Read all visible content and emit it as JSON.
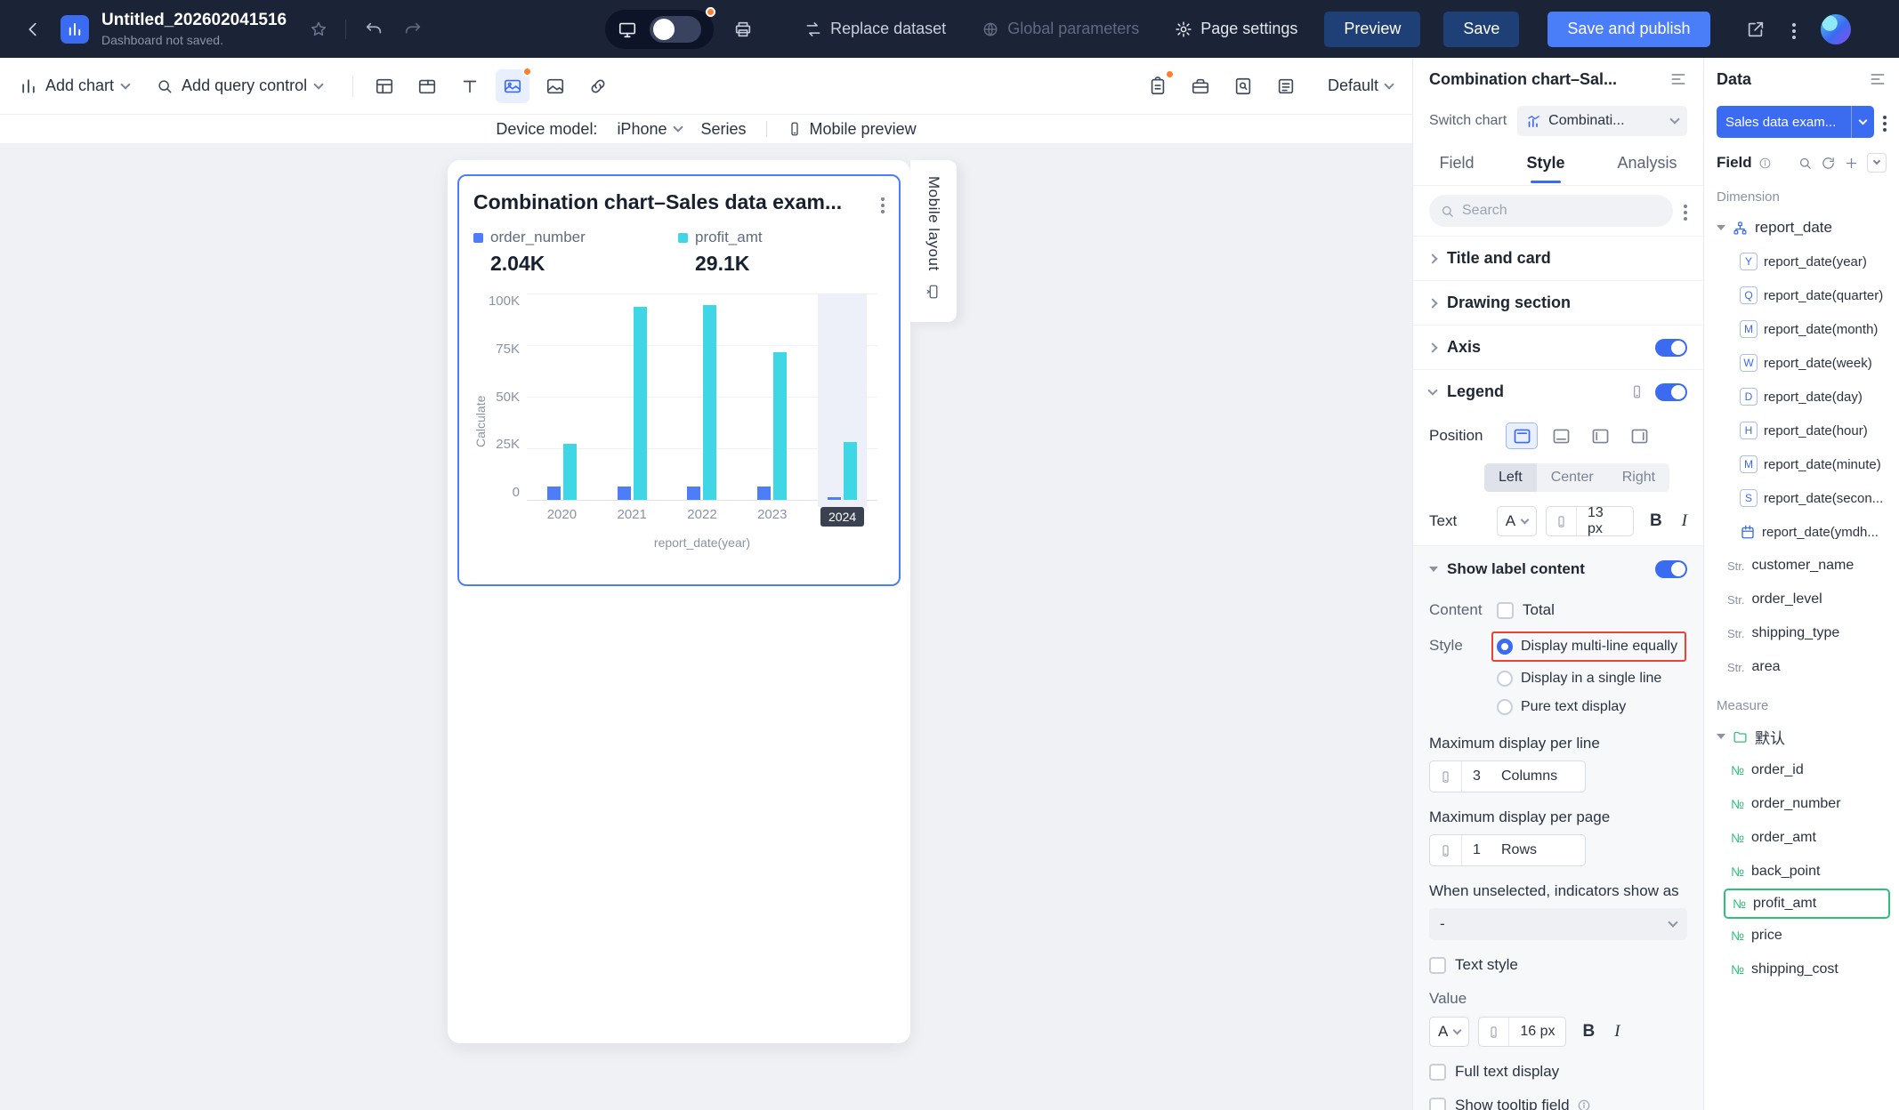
{
  "colors": {
    "accent_blue": "#3a6bf0",
    "publish_blue": "#4a7df8",
    "topbar_bg": "#1b2336",
    "measure_green": "#30bf78",
    "annotation_red": "#f04134"
  },
  "topbar": {
    "title": "Untitled_202602041516",
    "subtitle": "Dashboard not saved.",
    "replace_dataset_label": "Replace dataset",
    "global_parameters_label": "Global parameters",
    "page_settings_label": "Page settings",
    "preview_label": "Preview",
    "save_label": "Save",
    "save_and_publish_label": "Save and publish"
  },
  "toolbar": {
    "add_chart_label": "Add chart",
    "add_query_control_label": "Add query control",
    "theme_label": "Default"
  },
  "devicebar": {
    "device_model_label": "Device model:",
    "device_value": "iPhone",
    "series_label": "Series",
    "mobile_preview_label": "Mobile preview"
  },
  "canvas": {
    "mobile_layout_tab": "Mobile layout",
    "card": {
      "title": "Combination chart–Sales data exam...",
      "legend": [
        {
          "name": "order_number",
          "value": "2.04K"
        },
        {
          "name": "profit_amt",
          "value": "29.1K"
        }
      ]
    }
  },
  "chart_data": {
    "type": "bar",
    "title": "Combination chart–Sales data exam...",
    "categories": [
      "2020",
      "2021",
      "2022",
      "2023",
      "2024"
    ],
    "series": [
      {
        "name": "order_number",
        "color": "#4d7df8",
        "values": [
          6500,
          6500,
          6500,
          6500,
          1500
        ]
      },
      {
        "name": "profit_amt",
        "color": "#3fd6e6",
        "values": [
          27000,
          93500,
          94500,
          71500,
          28000
        ]
      }
    ],
    "legend_display_values": {
      "order_number": "2.04K",
      "profit_amt": "29.1K"
    },
    "xlabel": "report_date(year)",
    "ylabel": "Calculate",
    "yticks": [
      "100K",
      "75K",
      "50K",
      "25K",
      "0"
    ],
    "ylim": [
      0,
      100000
    ],
    "highlighted_category": "2024",
    "legend_position": "top",
    "grid": true
  },
  "style_panel": {
    "header": "Combination chart–Sal...",
    "switch_chart_label": "Switch chart",
    "switch_chart_value": "Combinati...",
    "tabs": [
      "Field",
      "Style",
      "Analysis"
    ],
    "active_tab": "Style",
    "search_placeholder": "Search",
    "sections": {
      "title_and_card": "Title and card",
      "drawing_section": "Drawing section",
      "axis": "Axis",
      "legend": "Legend"
    },
    "legend_settings": {
      "position_label": "Position",
      "alignment_options": [
        "Left",
        "Center",
        "Right"
      ],
      "text_label": "Text",
      "text_color": "A",
      "text_size": "13 px",
      "bold": "B",
      "italic": "I",
      "show_label_content_label": "Show label content",
      "content_label": "Content",
      "content_option": "Total",
      "style_label": "Style",
      "style_options": [
        "Display multi-line equally",
        "Display in a single line",
        "Pure text display"
      ],
      "selected_style": "Display multi-line equally",
      "max_per_line_label": "Maximum display per line",
      "max_per_line_value": "3",
      "max_per_line_unit": "Columns",
      "max_per_page_label": "Maximum display per page",
      "max_per_page_value": "1",
      "max_per_page_unit": "Rows",
      "unselected_label": "When unselected, indicators show as",
      "unselected_value": "-",
      "text_style_label": "Text style",
      "value_label": "Value",
      "value_color": "A",
      "value_size": "16 px",
      "full_text_display_label": "Full text display",
      "show_tooltip_field_label": "Show tooltip field"
    }
  },
  "data_panel": {
    "header": "Data",
    "dataset_name": "Sales data exam...",
    "field_label": "Field",
    "dimension_label": "Dimension",
    "dimension_parent": "report_date",
    "date_fields": [
      {
        "badge": "Y",
        "label": "report_date(year)"
      },
      {
        "badge": "Q",
        "label": "report_date(quarter)"
      },
      {
        "badge": "M",
        "label": "report_date(month)"
      },
      {
        "badge": "W",
        "label": "report_date(week)"
      },
      {
        "badge": "D",
        "label": "report_date(day)"
      },
      {
        "badge": "H",
        "label": "report_date(hour)"
      },
      {
        "badge": "M",
        "label": "report_date(minute)"
      },
      {
        "badge": "S",
        "label": "report_date(secon..."
      },
      {
        "badge": "",
        "label": "report_date(ymdh..."
      }
    ],
    "string_prefix": "Str.",
    "string_fields": [
      "customer_name",
      "order_level",
      "shipping_type",
      "area"
    ],
    "measure_label": "Measure",
    "measure_folder": "默认",
    "measure_prefix": "№",
    "measure_fields": [
      "order_id",
      "order_number",
      "order_amt",
      "back_point",
      "profit_amt",
      "price",
      "shipping_cost"
    ],
    "selected_measure": "profit_amt"
  }
}
